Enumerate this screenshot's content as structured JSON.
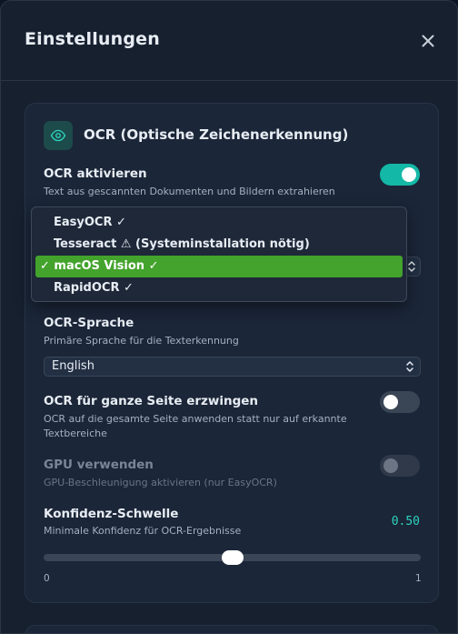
{
  "dialog": {
    "title": "Einstellungen"
  },
  "ocr_section": {
    "title": "OCR (Optische Zeichenerkennung)",
    "icon": "eye-icon",
    "accent": "#14b8a6",
    "enable": {
      "label": "OCR aktivieren",
      "description": "Text aus gescannten Dokumenten und Bildern extrahieren",
      "on": true
    },
    "engine": {
      "options": [
        {
          "label": "EasyOCR ✓",
          "selected": false
        },
        {
          "label": "Tesseract ⚠ (Systeminstallation nötig)",
          "selected": false
        },
        {
          "label": "✓ macOS Vision ✓",
          "selected": true
        },
        {
          "label": "RapidOCR ✓",
          "selected": false
        }
      ],
      "selected_color": "#43a32c"
    },
    "language": {
      "label": "OCR-Sprache",
      "description": "Primäre Sprache für die Texterkennung",
      "value": "English"
    },
    "force_full_page": {
      "label": "OCR für ganze Seite erzwingen",
      "description": "OCR auf die gesamte Seite anwenden statt nur auf erkannte Textbereiche",
      "on": false
    },
    "gpu": {
      "label": "GPU verwenden",
      "description": "GPU-Beschleunigung aktivieren (nur EasyOCR)",
      "on": false,
      "disabled": true
    },
    "confidence": {
      "label": "Konfidenz-Schwelle",
      "description": "Minimale Konfidenz für OCR-Ergebnisse",
      "value_text": "0.50",
      "value": 0.5,
      "min_label": "0",
      "max_label": "1"
    }
  }
}
